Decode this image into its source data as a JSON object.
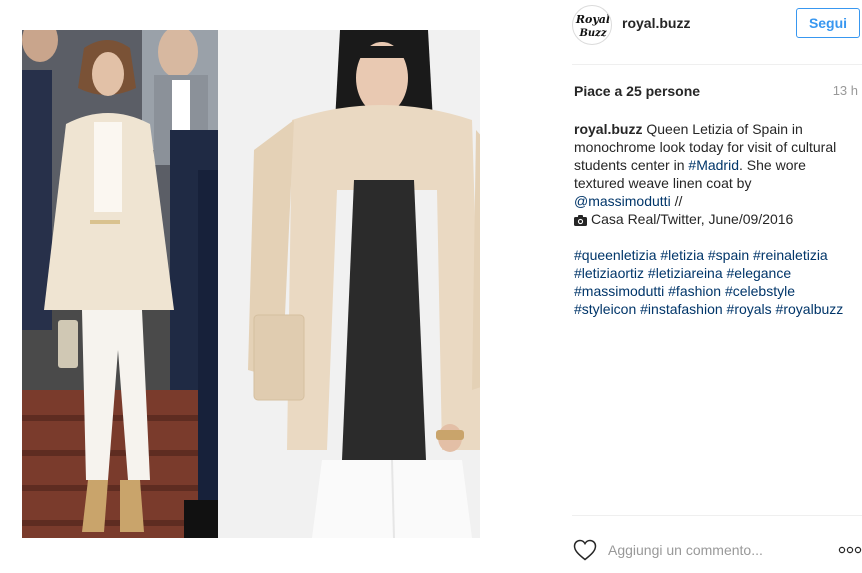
{
  "header": {
    "avatar_text_top": "Royal",
    "avatar_text_bottom": "Buzz",
    "username": "royal.buzz",
    "follow_label": "Segui"
  },
  "post": {
    "likes": "Piace a 25 persone",
    "time": "13 h",
    "caption": {
      "username": "royal.buzz",
      "line1": " Queen Letizia of Spain in",
      "line2": "monochrome look today for visit of cultural",
      "line3_pre": "students center in ",
      "line3_tag": "#Madrid",
      "line3_post": ". She wore",
      "line4": "textured weave linen coat by",
      "line5_mention": "@massimodutti",
      "line5_post": " //",
      "line6": "Casa Real/Twitter, June/09/2016"
    },
    "hashtags": [
      "#queenletizia #letizia #spain #reinaletizia",
      "#letiziaortiz #letiziareina #elegance",
      "#massimodutti #fashion #celebstyle",
      "#styleicon #instafashion #royals #royalbuzz"
    ]
  },
  "comment": {
    "placeholder": "Aggiungi un commento..."
  },
  "icons": {
    "heart": "heart-icon",
    "camera": "camera-icon",
    "more": "more-options-icon"
  },
  "colors": {
    "accent": "#3897f0",
    "hashtag": "#003569",
    "muted": "#999999",
    "coat": "#ead9c2",
    "top": "#2b2b2b"
  }
}
